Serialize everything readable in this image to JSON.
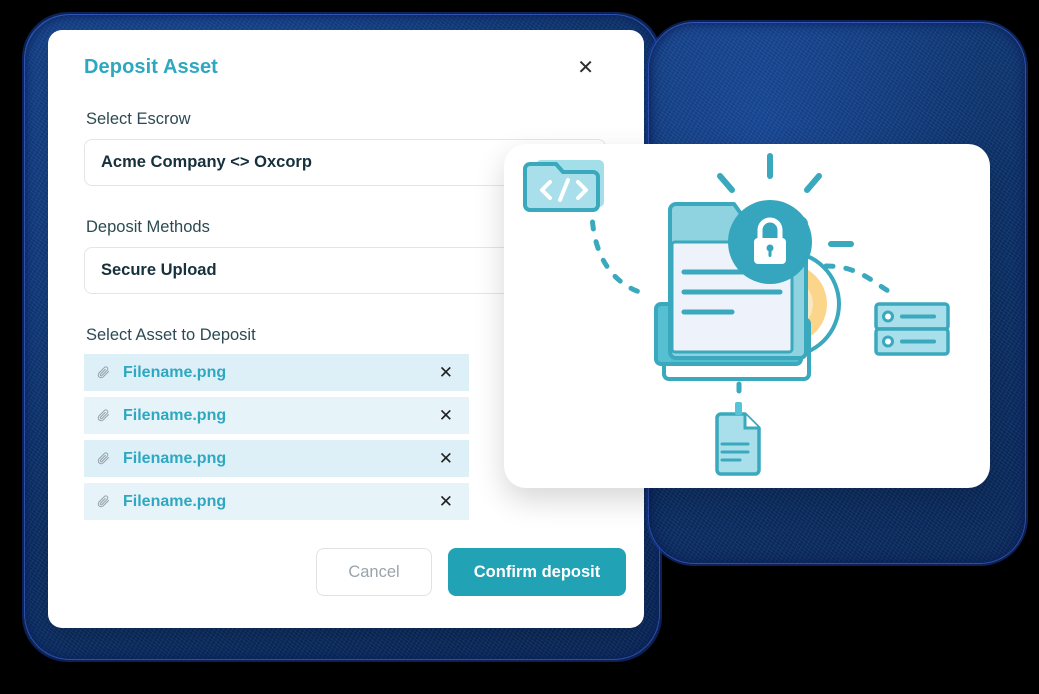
{
  "theme": {
    "accent_teal": "#2ea8c0",
    "confirm_teal": "#21a3b5",
    "navy_backdrop": "#0c2f63",
    "row_bg": "#ddf0f8",
    "row_bg_alt": "#e6f4fa",
    "text_dark": "#16303c",
    "label_grey": "#2c4a52",
    "cancel_grey": "#9aa4ab",
    "page_background": "#000000"
  },
  "modal": {
    "title": "Deposit Asset",
    "close_label": "✕",
    "close_icon_name": "close-icon",
    "fields": {
      "escrow": {
        "label": "Select Escrow",
        "value": "Acme Company <> Oxcorp"
      },
      "deposit_method": {
        "label": "Deposit Methods",
        "value": "Secure Upload"
      },
      "assets": {
        "label": "Select Asset to Deposit"
      }
    },
    "files": [
      {
        "name": "Filename.png",
        "remove_label": "✕",
        "icon": "paperclip-icon"
      },
      {
        "name": "Filename.png",
        "remove_label": "✕",
        "icon": "paperclip-icon"
      },
      {
        "name": "Filename.png",
        "remove_label": "✕",
        "icon": "paperclip-icon"
      },
      {
        "name": "Filename.png",
        "remove_label": "✕",
        "icon": "paperclip-icon"
      }
    ],
    "footer": {
      "cancel_label": "Cancel",
      "confirm_label": "Confirm deposit"
    }
  },
  "illustration": {
    "name": "secure-deposit-illustration",
    "elements": [
      "code-folder-icon",
      "main-folder-icon",
      "document-page-icon",
      "lock-badge-icon",
      "sunburst-rays",
      "disc-icon",
      "server-icon",
      "document-tag-icon",
      "dashed-connector-lines"
    ],
    "colors": {
      "folder_fill": "#8fd3e0",
      "folder_stroke": "#2e9cb4",
      "page_fill": "#eef2fb",
      "lock_circle": "#35a6bd",
      "disc_accent": "#fbd58a"
    }
  }
}
